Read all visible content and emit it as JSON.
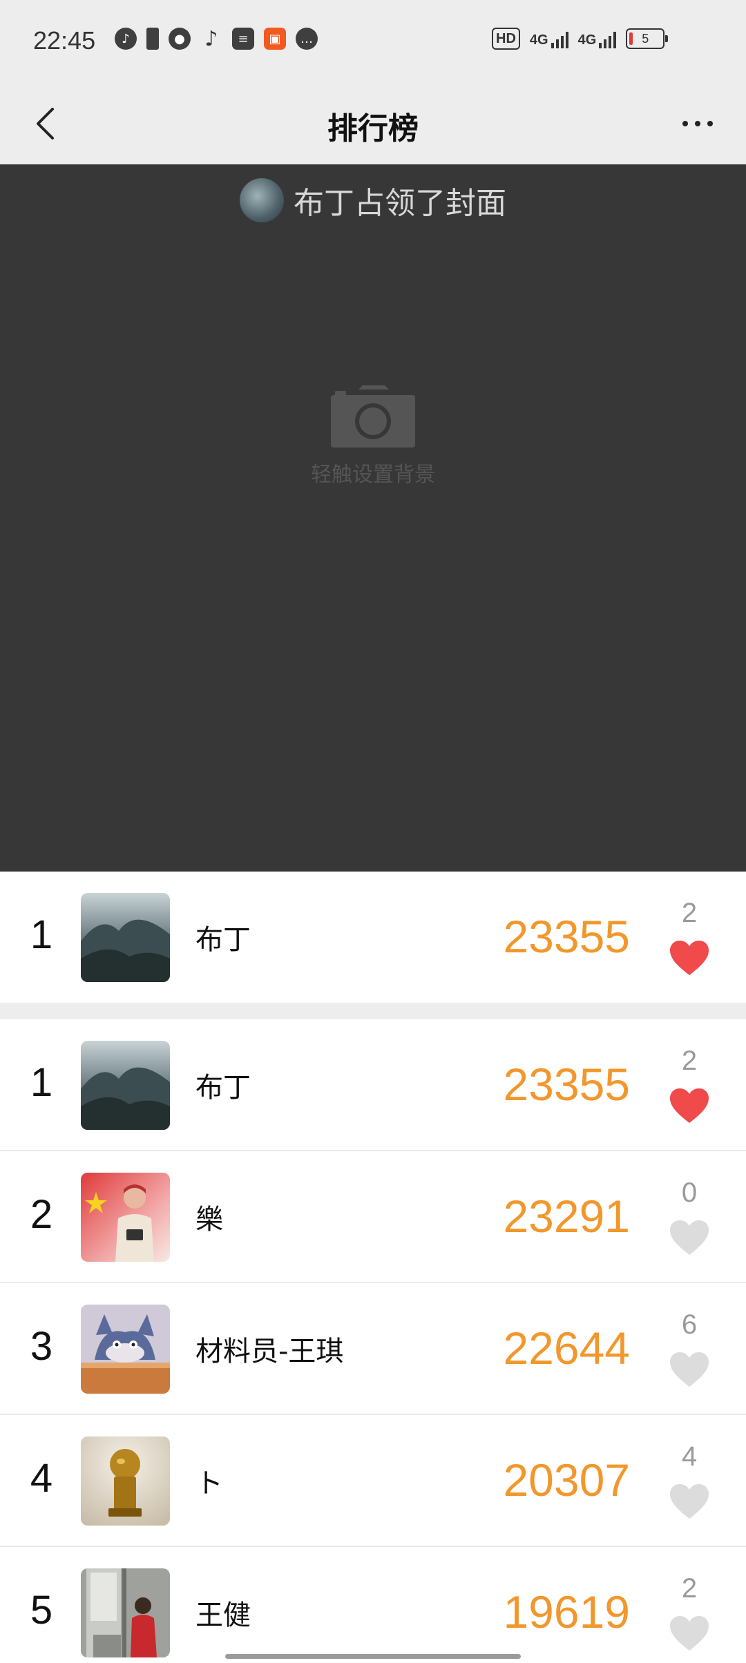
{
  "status_bar": {
    "time": "22:45",
    "left_icons": [
      "music-app-icon",
      "battery-saver-icon",
      "qq-icon",
      "tiktok-icon",
      "news-icon",
      "kuaishou-icon",
      "chat-icon"
    ],
    "network": [
      "HD",
      "4G",
      "4G"
    ],
    "battery_level": "5"
  },
  "nav": {
    "title": "排行榜"
  },
  "cover": {
    "owner_text": "布丁占领了封面",
    "camera_label": "轻触设置背景"
  },
  "my_rank": {
    "rank": "1",
    "name": "布丁",
    "steps": "23355",
    "likes": "2",
    "liked": true
  },
  "ranking": [
    {
      "rank": "1",
      "name": "布丁",
      "steps": "23355",
      "likes": "2",
      "liked": true
    },
    {
      "rank": "2",
      "name": "樂",
      "steps": "23291",
      "likes": "0",
      "liked": false
    },
    {
      "rank": "3",
      "name": "材料员-王琪",
      "steps": "22644",
      "likes": "6",
      "liked": false
    },
    {
      "rank": "4",
      "name": "ト",
      "steps": "20307",
      "likes": "4",
      "liked": false
    },
    {
      "rank": "5",
      "name": "王健",
      "steps": "19619",
      "likes": "2",
      "liked": false
    }
  ],
  "colors": {
    "accent_steps": "#f2972c",
    "heart_liked": "#f04a4a",
    "heart_unliked": "#dcdcdc",
    "cover_bg": "#373737"
  }
}
